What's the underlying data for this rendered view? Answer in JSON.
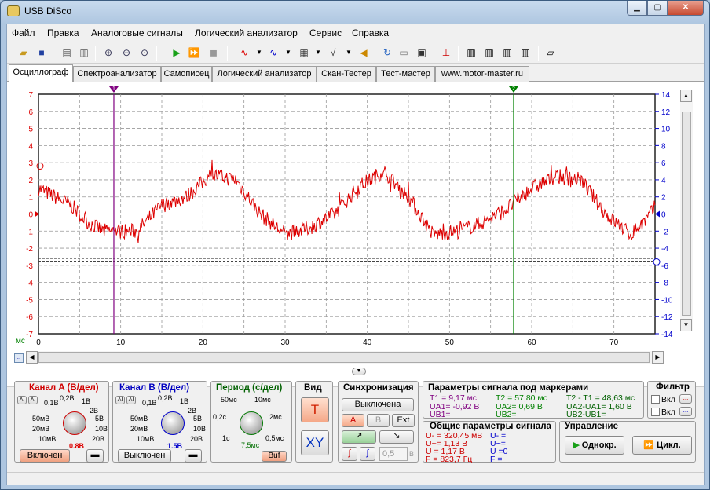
{
  "window": {
    "title": "USB DiSco"
  },
  "menu": [
    "Файл",
    "Правка",
    "Аналоговые сигналы",
    "Логический анализатор",
    "Сервис",
    "Справка"
  ],
  "tabs": [
    "Осциллограф",
    "Спектроанализатор",
    "Самописец",
    "Логический анализатор",
    "Скан-Тестер",
    "Тест-мастер",
    "www.motor-master.ru"
  ],
  "scope": {
    "left_ticks": [
      "7",
      "6",
      "5",
      "4",
      "3",
      "2",
      "1",
      "0",
      "-1",
      "-2",
      "-3",
      "-4",
      "-5",
      "-6",
      "-7"
    ],
    "right_ticks": [
      "14",
      "12",
      "10",
      "8",
      "6",
      "4",
      "2",
      "0",
      "-2",
      "-4",
      "-6",
      "-8",
      "-10",
      "-12",
      "-14"
    ],
    "x_ticks": [
      "0",
      "10",
      "20",
      "30",
      "40",
      "50",
      "60",
      "70"
    ],
    "x_unit": "мс",
    "marker1_label": "1",
    "marker2_label": "2",
    "marker1_ms": 9.17,
    "marker2_ms": 57.8,
    "colors": {
      "signal": "#dd0000",
      "grid": "#999999",
      "marker1": "#800080",
      "marker2": "#008000",
      "right_axis": "#0000cc"
    }
  },
  "channel_a": {
    "title": "Канал A (В/дел)",
    "value": "0.8В",
    "button": "Включен",
    "labels": [
      "0,1В",
      "0,2В",
      "1В",
      "2В",
      "50мВ",
      "5В",
      "20мВ",
      "10В",
      "10мВ",
      "20В"
    ],
    "mode1": "AI",
    "mode2": "AI"
  },
  "channel_b": {
    "title": "Канал B (В/дел)",
    "value": "1.5В",
    "button": "Выключен",
    "labels": [
      "0,1В",
      "0,2В",
      "1В",
      "2В",
      "50мВ",
      "5В",
      "20мВ",
      "10В",
      "10мВ",
      "20В"
    ],
    "mode1": "AI",
    "mode2": "AI"
  },
  "period": {
    "title": "Период (с/дел)",
    "labels": [
      "50мс",
      "10мс",
      "0,2с",
      "2мс",
      "1с",
      "0,5мс"
    ],
    "value": "7,5мс",
    "buf": "Buf"
  },
  "view": {
    "title": "Вид",
    "t": "T",
    "xy": "XY"
  },
  "sync": {
    "title": "Синхронизация",
    "state": "Выключена",
    "a": "A",
    "b": "B",
    "ext": "Ext",
    "level": "0,5",
    "unit": "В"
  },
  "markers": {
    "title": "Параметры сигнала под маркерами",
    "t1": "T1 = 9,17 мс",
    "t2": "T2 = 57,80 мс",
    "dt": "T2 - T1 = 48,63 мс",
    "ua1": "UA1= -0,92 В",
    "ua2": "UA2= 0,69 В",
    "dua": "UA2-UA1= 1,60 В",
    "ub1": "UB1=",
    "ub2": "UB2=",
    "dub": "UB2-UB1="
  },
  "general": {
    "title": "Общие параметры сигнала",
    "l1": "U- = 320,45 мВ",
    "l2": "U~= 1,13 В",
    "l3": "U = 1,17 В",
    "l4": "F = 823,7 Гц",
    "r1": "U- =",
    "r2": "U~=",
    "r3": "U =0",
    "r4": "F ="
  },
  "filter": {
    "title": "Фильтр",
    "on1": "Вкл",
    "on2": "Вкл"
  },
  "control": {
    "title": "Управление",
    "single": "Однокр.",
    "cycle": "Цикл."
  }
}
